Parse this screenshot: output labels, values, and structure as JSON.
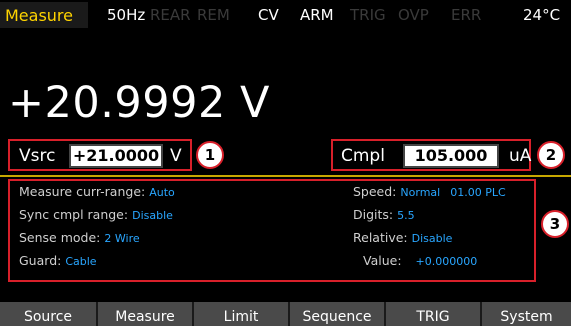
{
  "status_bar": {
    "mode_tab": "Measure",
    "items": [
      {
        "text": "50Hz",
        "active": true
      },
      {
        "text": "REAR",
        "active": false
      },
      {
        "text": "REM",
        "active": false
      },
      {
        "text": "CV",
        "active": true
      },
      {
        "text": "ARM",
        "active": true
      },
      {
        "text": "TRIG",
        "active": false
      },
      {
        "text": "OVP",
        "active": false
      },
      {
        "text": "ERR",
        "active": false
      },
      {
        "text": "24°C",
        "active": true
      }
    ]
  },
  "reading": "+20.9992 V",
  "source": {
    "label": "Vsrc",
    "value": "+21.0000",
    "unit": "V"
  },
  "compliance": {
    "label": "Cmpl",
    "value": "105.000",
    "unit": "uA"
  },
  "badges": [
    "1",
    "2",
    "3"
  ],
  "settings_left": [
    {
      "label": "Measure curr-range:",
      "value": "Auto"
    },
    {
      "label": "Sync cmpl range:",
      "value": "Disable"
    },
    {
      "label": "Sense mode:",
      "value": "2 Wire"
    },
    {
      "label": "Guard:",
      "value": "Cable"
    }
  ],
  "settings_right": [
    {
      "label": "Speed:",
      "value": "Normal",
      "extra": "01.00 PLC"
    },
    {
      "label": "Digits:",
      "value": "5.5"
    },
    {
      "label": "Relative:",
      "value": "Disable"
    },
    {
      "label": "Value:",
      "value": "+0.000000"
    }
  ],
  "softkeys": [
    "Source",
    "Measure",
    "Limit",
    "Sequence",
    "TRIG",
    "System"
  ],
  "colors": {
    "accent": "#ffd400",
    "value_blue": "#29a6ff",
    "callout_red": "#d8202a"
  }
}
